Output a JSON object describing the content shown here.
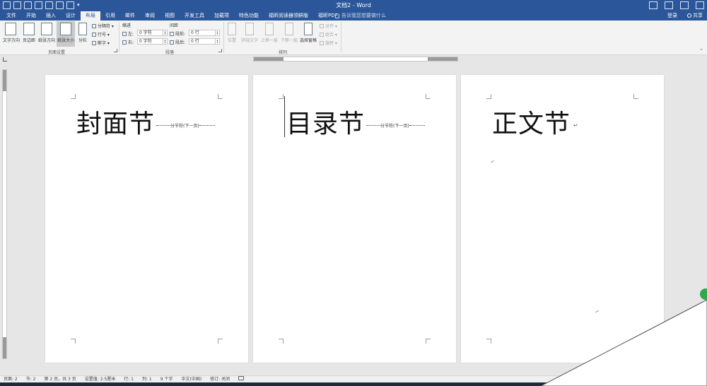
{
  "window": {
    "doc_title": "文档2 - Word"
  },
  "tabs": [
    {
      "label": "文件",
      "active": false
    },
    {
      "label": "开始",
      "active": false
    },
    {
      "label": "插入",
      "active": false
    },
    {
      "label": "设计",
      "active": false
    },
    {
      "label": "布局",
      "active": true
    },
    {
      "label": "引用",
      "active": false
    },
    {
      "label": "邮件",
      "active": false
    },
    {
      "label": "审阅",
      "active": false
    },
    {
      "label": "视图",
      "active": false
    },
    {
      "label": "开发工具",
      "active": false
    },
    {
      "label": "加载项",
      "active": false
    },
    {
      "label": "特色功能",
      "active": false
    },
    {
      "label": "福昕阅读器领鲜版",
      "active": false
    },
    {
      "label": "福昕PDF",
      "active": false
    }
  ],
  "tellme": {
    "placeholder": "告诉我您想要做什么"
  },
  "account": {
    "login": "登录",
    "share": "共享"
  },
  "ribbon": {
    "page_setup": {
      "text_direction": "文字方向",
      "margins": "页边距",
      "orientation": "纸张方向",
      "size": "纸张大小",
      "columns": "分栏",
      "breaks": "分隔符",
      "line_numbers": "行号",
      "hyphenation": "断字",
      "group": "页面设置"
    },
    "paragraph": {
      "indent": "缩进",
      "spacing": "间距",
      "left": "左:",
      "right": "右:",
      "left_value": "0 字符",
      "right_value": "0 字符",
      "before": "段前:",
      "after": "段后:",
      "before_value": "0 行",
      "after_value": "0 行",
      "group": "段落"
    },
    "arrange": {
      "position": "位置",
      "wrap_text": "环绕文字",
      "bring_forward": "上移一层",
      "send_backward": "下移一层",
      "selection_pane": "选择窗格",
      "align": "对齐",
      "group_btn": "组合",
      "rotate": "旋转",
      "group": "排列"
    }
  },
  "pages": [
    {
      "heading": "封面节",
      "break_label": "分节符(下一页)"
    },
    {
      "heading": "目录节",
      "break_label": "分节符(下一页)"
    },
    {
      "heading": "正文节"
    }
  ],
  "status": {
    "page": "页面: 2",
    "section": "节: 2",
    "page_of": "第 2 页，共 3 页",
    "position": "设置值: 2.5厘米",
    "line": "行: 1",
    "column": "列: 1",
    "words": "9 个字",
    "language": "中文(中国)",
    "track": "修订: 关闭"
  }
}
